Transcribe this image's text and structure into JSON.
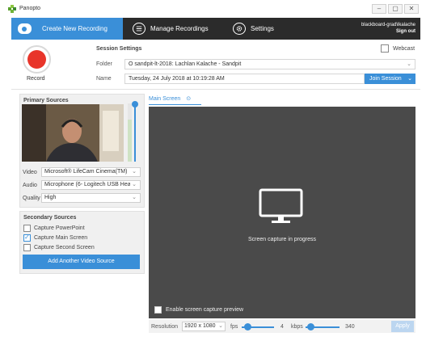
{
  "app": {
    "title": "Panopto"
  },
  "window_controls": {
    "minimize": "–",
    "maximize": "▢",
    "close": "✕"
  },
  "nav": {
    "create": "Create New Recording",
    "manage": "Manage Recordings",
    "settings": "Settings"
  },
  "user": {
    "name": "blackboard-grad\\lkalache",
    "signout": "Sign out"
  },
  "record": {
    "label": "Record"
  },
  "session": {
    "title": "Session Settings",
    "folder_label": "Folder",
    "folder_value": "O sandpit-lt-2018: Lachlan Kalache - Sandpit",
    "name_label": "Name",
    "name_value": "Tuesday, 24 July 2018 at 10:19:28 AM",
    "webcast": "Webcast",
    "join": "Join Session"
  },
  "primary": {
    "title": "Primary Sources",
    "video_label": "Video",
    "video_value": "Microsoft® LifeCam Cinema(TM)",
    "audio_label": "Audio",
    "audio_value": "Microphone (6- Logitech USB Hea",
    "quality_label": "Quality",
    "quality_value": "High"
  },
  "secondary": {
    "title": "Secondary Sources",
    "items": [
      {
        "label": "Capture PowerPoint",
        "checked": false
      },
      {
        "label": "Capture Main Screen",
        "checked": true
      },
      {
        "label": "Capture Second Screen",
        "checked": false
      }
    ],
    "add": "Add Another Video Source"
  },
  "main": {
    "tab": "Main Screen",
    "status": "Screen capture in progress",
    "preview_toggle": "Enable screen capture preview"
  },
  "bottom": {
    "resolution_label": "Resolution",
    "resolution_value": "1920 x 1080",
    "fps_label": "fps",
    "fps_value": "4",
    "kbps_label": "kbps",
    "kbps_value": "340",
    "apply": "Apply"
  },
  "colors": {
    "accent": "#3a8fd8",
    "nav_bg": "#2b2b2b",
    "record": "#e8352a",
    "preview_bg": "#4a4a4a"
  }
}
